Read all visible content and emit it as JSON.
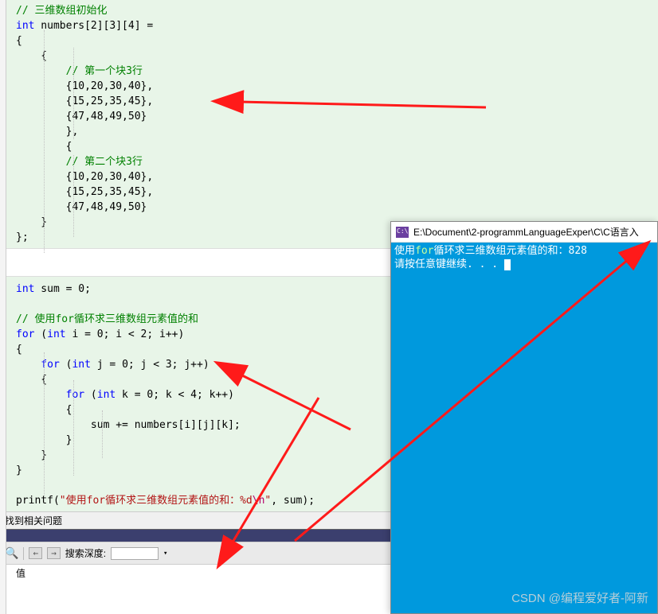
{
  "code": {
    "c1": "// 三维数组初始化",
    "l2a": "int",
    "l2b": " numbers[2][3][4] =",
    "l3": "{",
    "l4": "    {",
    "c5": "        // 第一个块3行",
    "l6": "        {10,20,30,40},",
    "l7": "        {15,25,35,45},",
    "l8": "        {47,48,49,50}",
    "l9": "        },",
    "l10": "        {",
    "c11": "        // 第二个块3行",
    "l12": "        {10,20,30,40},",
    "l13": "        {15,25,35,45},",
    "l14": "        {47,48,49,50}",
    "l15": "    }",
    "l16": "};",
    "s1a": "int",
    "s1b": " sum = 0;",
    "sc2": "// 使用for循环求三维数组元素值的和",
    "s3a": "for",
    "s3b": " (",
    "s3c": "int",
    "s3d": " i = 0; i < 2; i++)",
    "s4": "{",
    "s5a": "    for",
    "s5b": " (",
    "s5c": "int",
    "s5d": " j = 0; j < 3; j++)",
    "s6": "    {",
    "s7a": "        for",
    "s7b": " (",
    "s7c": "int",
    "s7d": " k = 0; k < 4; k++)",
    "s8": "        {",
    "s9": "            sum += numbers[i][j][k];",
    "s10": "        }",
    "s11": "    }",
    "s12": "}",
    "p1a": "printf(",
    "p1s": "\"使用for循环求三维数组元素值的和：%d",
    "p1e": "\\n",
    "p1s2": "\"",
    "p1b": ", sum);"
  },
  "console": {
    "title": "E:\\Document\\2-programmLanguageExper\\C\\C语言入",
    "out1a": "使用",
    "out1b": "for",
    "out1c": "循环求三维数组元素值的和：828",
    "out2": "请按任意键继续. . ."
  },
  "ui": {
    "status": "找到相关问题",
    "search_label": "搜索深度:",
    "bottom_tab": "值",
    "watermark": "CSDN @编程爱好者-阿新"
  }
}
